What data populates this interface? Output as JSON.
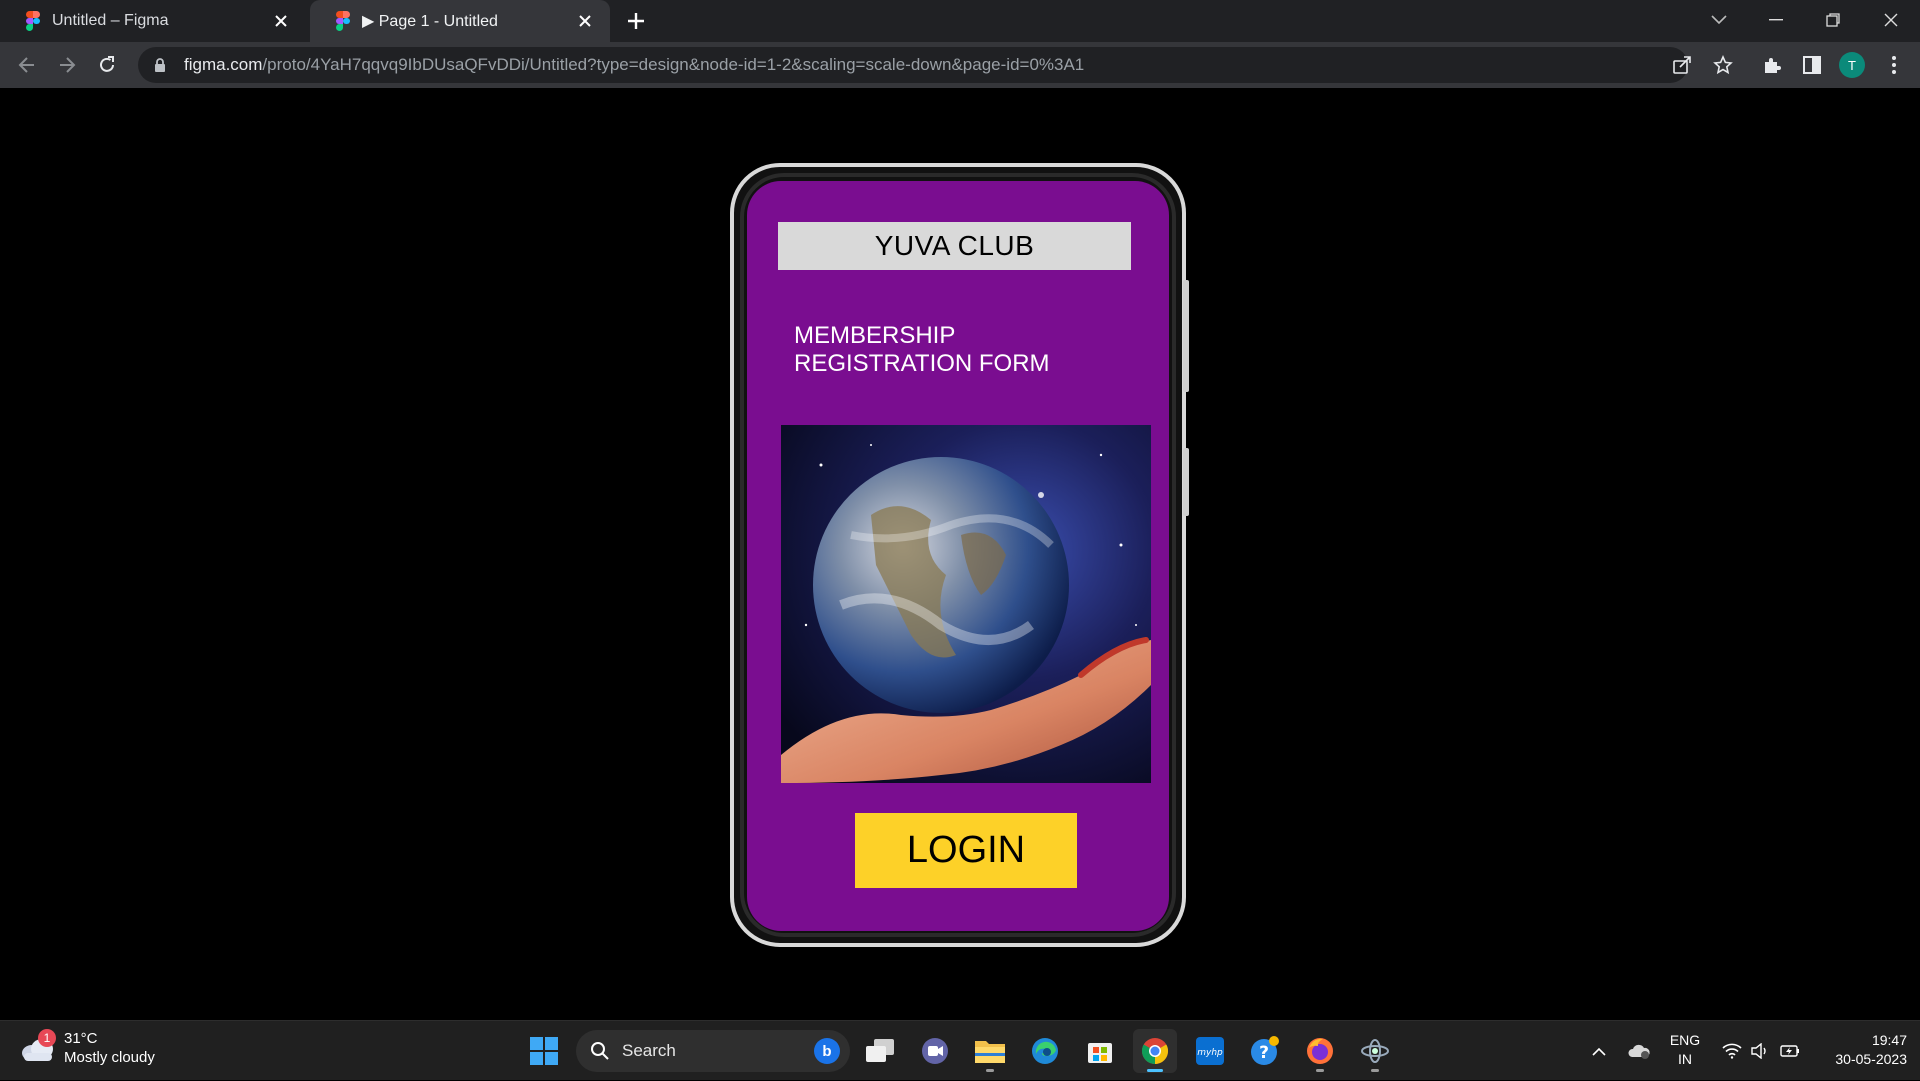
{
  "browser": {
    "tabs": [
      {
        "title": "Untitled – Figma",
        "active": false
      },
      {
        "title": "▶ Page 1 - Untitled",
        "active": true
      }
    ],
    "url_host": "figma.com",
    "url_path": "/proto/4YaH7qqvq9IbDUsaQFvDDi/Untitled?type=design&node-id=1-2&scaling=scale-down&page-id=0%3A1",
    "profile_initial": "T",
    "profile_color": "#0b8a7a"
  },
  "prototype": {
    "club_name": "YUVA CLUB",
    "form_title": "MEMBERSHIP REGISTRATION FORM",
    "login_label": "LOGIN",
    "screen_color": "#7a0d90",
    "button_color": "#fdd128",
    "image": "earth-in-hand"
  },
  "taskbar": {
    "weather_temp": "31°C",
    "weather_desc": "Mostly cloudy",
    "weather_badge": "1",
    "search_label": "Search",
    "language": "ENG",
    "region": "IN",
    "time": "19:47",
    "date": "30-05-2023",
    "apps": [
      "start-icon",
      "search-box",
      "task-view-icon",
      "teams-chat-icon",
      "file-explorer-icon",
      "edge-icon",
      "microsoft-store-icon",
      "chrome-icon",
      "myhp-icon",
      "get-help-icon",
      "firefox-icon",
      "app-icon"
    ]
  }
}
